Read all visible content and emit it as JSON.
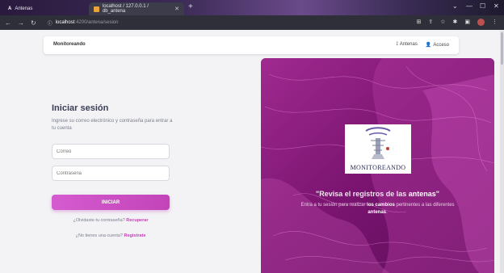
{
  "browser": {
    "tabs": [
      {
        "label": "Antenas",
        "icon": "A"
      },
      {
        "label": "localhost / 127.0.0.1 / db_antena",
        "icon": "phpmyadmin-icon"
      }
    ],
    "new_tab": "+",
    "url_host": "localhost",
    "url_path": ":4200/antena/sesion"
  },
  "navbar": {
    "brand": "Monitoreando",
    "links": [
      {
        "label": "Antenas",
        "icon": "antenna-icon"
      },
      {
        "label": "Acceso",
        "icon": "user-icon"
      }
    ]
  },
  "login": {
    "title": "Iniciar sesión",
    "subtitle": "Ingrese su correo electrónico y contraseña para entrar a tu cuenta",
    "email_placeholder": "Correo",
    "password_placeholder": "Contraseña",
    "submit_label": "INICIAR",
    "forgot_text": "¿Olvidaste tu contraseña?",
    "forgot_link": "Recuperar",
    "register_text": "¿No tienes una cuenta?",
    "register_link": "Registrate"
  },
  "panel": {
    "logo_text": "MONITOREANDO",
    "headline_pre": "\"Revisa el registros de las ",
    "headline_bold": "antenas",
    "headline_post": "\"",
    "text_pre": "Entra a tu sesión para realizar ",
    "text_bold1": "los cambios",
    "text_mid": " pertinentes a las diferentes ",
    "text_bold2": "antenas",
    "text_post": ".",
    "colors": {
      "bg": "#8a1a7a",
      "accent": "#c244b8"
    }
  }
}
